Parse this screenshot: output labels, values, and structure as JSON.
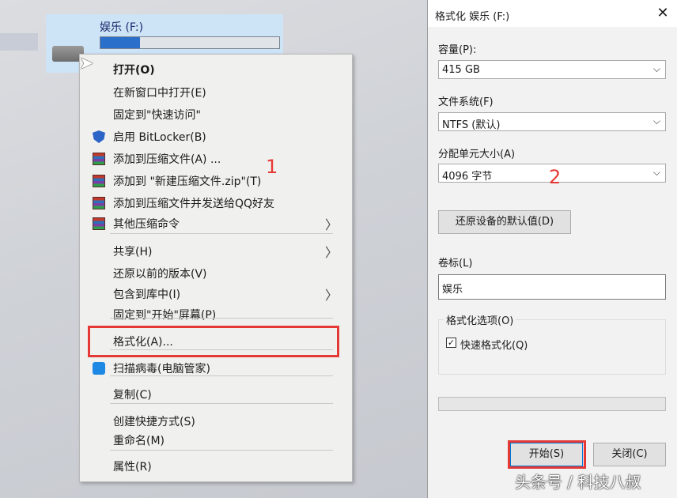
{
  "drive": {
    "label": "娱乐 (F:)",
    "usage_fraction": 0.22,
    "usage_color": "#2a6fc9"
  },
  "context_menu": {
    "items": [
      {
        "label": "打开(O)",
        "icon": "",
        "submenu": false
      },
      {
        "label": "在新窗口中打开(E)",
        "icon": "",
        "submenu": false
      },
      {
        "label": "固定到\"快速访问\"",
        "icon": "",
        "submenu": false
      },
      {
        "label": "启用 BitLocker(B)",
        "icon": "shield-icon",
        "submenu": false
      },
      {
        "label": "添加到压缩文件(A) ...",
        "icon": "archive-icon",
        "submenu": false
      },
      {
        "label": "添加到 \"新建压缩文件.zip\"(T)",
        "icon": "archive-icon",
        "submenu": false
      },
      {
        "label": "添加到压缩文件并发送给QQ好友",
        "icon": "archive-icon",
        "submenu": false
      },
      {
        "label": "其他压缩命令",
        "icon": "archive-icon",
        "submenu": true
      },
      {
        "label": "共享(H)",
        "icon": "",
        "submenu": true
      },
      {
        "label": "还原以前的版本(V)",
        "icon": "",
        "submenu": false
      },
      {
        "label": "包含到库中(I)",
        "icon": "",
        "submenu": true
      },
      {
        "label": "固定到\"开始\"屏幕(P)",
        "icon": "",
        "submenu": false
      },
      {
        "label": "格式化(A)...",
        "icon": "",
        "submenu": false
      },
      {
        "label": "扫描病毒(电脑管家)",
        "icon": "scan-icon",
        "submenu": false
      },
      {
        "label": "复制(C)",
        "icon": "",
        "submenu": false
      },
      {
        "label": "创建快捷方式(S)",
        "icon": "",
        "submenu": false
      },
      {
        "label": "重命名(M)",
        "icon": "",
        "submenu": false
      },
      {
        "label": "属性(R)",
        "icon": "",
        "submenu": false
      }
    ],
    "step_label": "1",
    "highlight_color": "#e53935"
  },
  "dialog": {
    "title": "格式化 娱乐 (F:)",
    "close_glyph": "✕",
    "capacity_label": "容量(P):",
    "capacity_value": "415 GB",
    "filesystem_label": "文件系统(F)",
    "filesystem_value": "NTFS (默认)",
    "alloc_label": "分配单元大小(A)",
    "alloc_value": "4096 字节",
    "restore_button": "还原设备的默认值(D)",
    "volume_label": "卷标(L)",
    "volume_value": "娱乐",
    "options_label": "格式化选项(O)",
    "quick_format_label": "快速格式化(Q)",
    "quick_format_checked": true,
    "progress_fraction": 0,
    "start_button": "开始(S)",
    "close_button": "关闭(C)",
    "step_label": "2"
  },
  "watermark": "头条号 / 科技八叔"
}
